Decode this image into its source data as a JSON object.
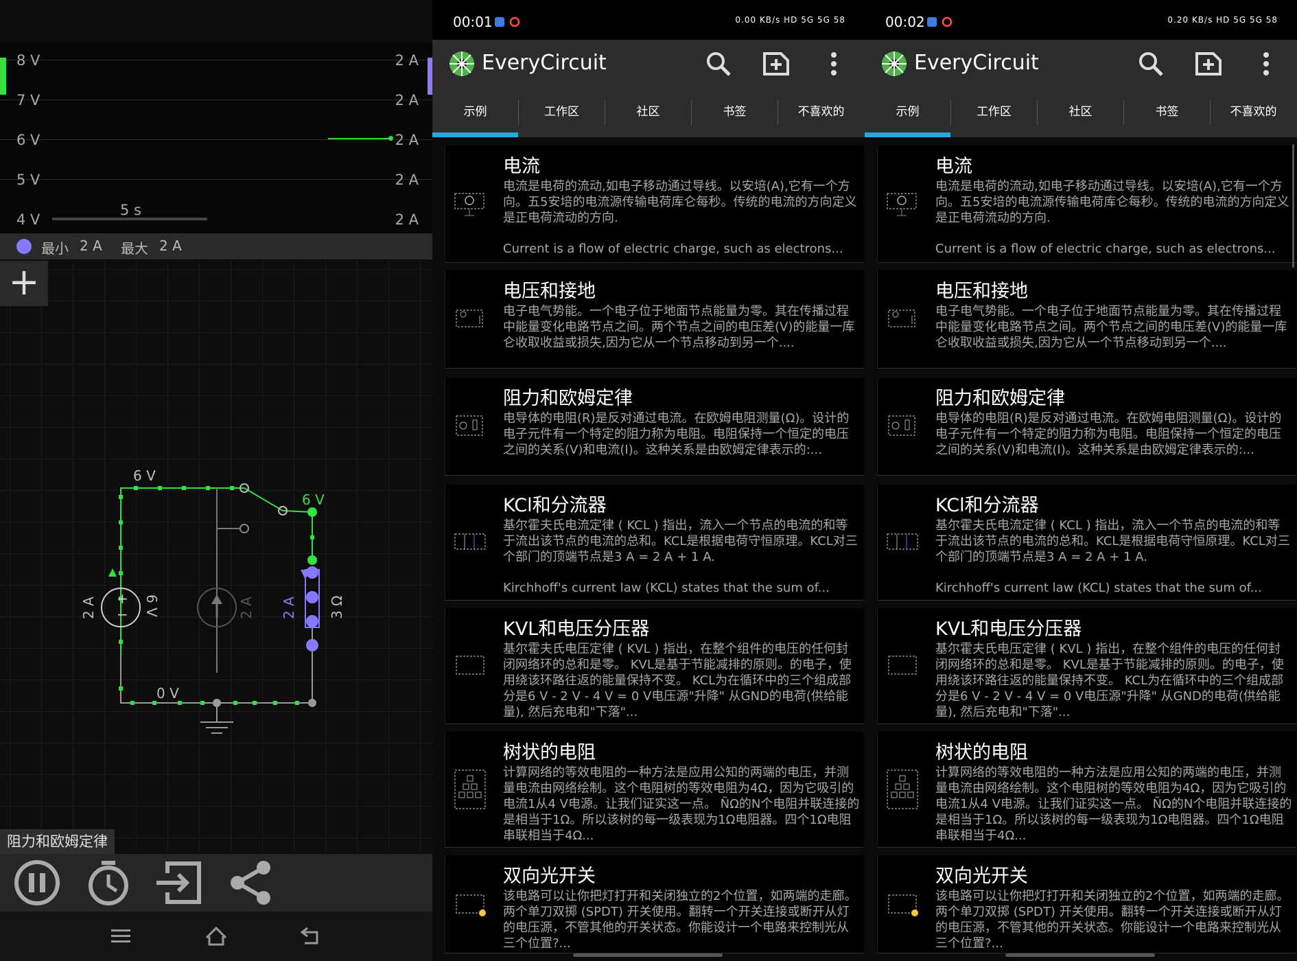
{
  "simulator": {
    "scope": {
      "rows": [
        {
          "left": "8 V",
          "right": "2 A"
        },
        {
          "left": "7 V",
          "right": "2 A"
        },
        {
          "left": "6 V",
          "right": "2 A"
        },
        {
          "left": "5 V",
          "right": "2 A"
        },
        {
          "left": "4 V",
          "right": "2 A"
        }
      ],
      "time_label": "5 s",
      "green_trace_level_v": 6
    },
    "legend": {
      "min_label": "最小",
      "min_value": "2 A",
      "max_label": "最大",
      "max_value": "2 A"
    },
    "add_icon": "plus-icon",
    "circuit_labels": {
      "top_node": "6 V",
      "right_node": "6 V",
      "ground_node": "0 V",
      "source1_current": "2 A",
      "source1_voltage": "6 V",
      "source2_current": "2 A",
      "resistor_current": "2 A",
      "resistor_value": "3 Ω"
    },
    "circuit_title": "阻力和欧姆定律",
    "toolbar_icons": [
      "pause-icon",
      "clock-icon",
      "export-icon",
      "share-icon"
    ],
    "nav_icons": [
      "menu-icon",
      "home-icon",
      "back-icon"
    ],
    "colors": {
      "voltage_green": "#33e040",
      "current_purple": "#8579ff",
      "wire_gray": "#9a9a9a"
    }
  },
  "panels": [
    {
      "status_time": "00:01",
      "status_right": "0.00 KB/s  HD  5G  5G  58",
      "app_title": "EveryCircuit",
      "tabs": [
        "示例",
        "工作区",
        "社区",
        "书签",
        "不喜欢的"
      ],
      "active_tab": 0
    },
    {
      "status_time": "00:02",
      "status_right": "0.20 KB/s  HD  5G  5G  58",
      "app_title": "EveryCircuit",
      "tabs": [
        "示例",
        "工作区",
        "社区",
        "书签",
        "不喜欢的"
      ],
      "active_tab": 0
    }
  ],
  "cards": [
    {
      "title": "电流",
      "desc": "电流是电荷的流动,如电子移动通过导线。以安培(A),它有一个方向。五5安培的电流源传输电荷库仑每秒。传统的电流的方向定义是正电荷流动的方向.",
      "en": "Current is a flow of electric charge, such as electrons..."
    },
    {
      "title": "电压和接地",
      "desc": "电子电气势能。一个电子位于地面节点能量为零。其在传播过程中能量变化电路节点之间。两个节点之间的电压差(V)的能量一库仑收取收益或损失,因为它从一个节点移动到另一个....",
      "en": ""
    },
    {
      "title": "阻力和欧姆定律",
      "desc": "电导体的电阻(R)是反对通过电流。在欧姆电阻测量(Ω)。设计的电子元件有一个特定的阻力称为电阻。电阻保持一个恒定的电压之间的关系(V)和电流(I)。这种关系是由欧姆定律表示的:...",
      "en": ""
    },
    {
      "title": "KCl和分流器",
      "desc": "基尔霍夫氏电流定律 ( KCL ) 指出，流入一个节点的电流的和等于流出该节点的电流的总和。KCL是根据电荷守恒原理。KCL对三个部门的顶端节点是3 A = 2 A + 1 A.",
      "en": "Kirchhoff's current law (KCL) states that the sum of..."
    },
    {
      "title": "KVL和电压分压器",
      "desc": "基尔霍夫氏电压定律 ( KVL ) 指出，在整个组件的电压的任何封闭网络环的总和是零。 KVL是基于节能减排的原则。的电子，使用绕该环路往返的能量保持不变。 KCL为在循环中的三个组成部分是6 V - 2 V - 4 V = 0 V电压源\"升降\" 从GND的电荷(供给能量), 然后充电和\"下落\"...",
      "en": ""
    },
    {
      "title": "树状的电阻",
      "desc": "计算网络的等效电阻的一种方法是应用公知的两端的电压，并测量电流由网络绘制。这个电阻树的等效电阻为4Ω，因为它吸引的电流1从4 V电源。让我们证实这一点。 ÑΩ的N个电阻并联连接的是相当于1Ω。所以该树的每一级表现为1Ω电阻器。四个1Ω电阻串联相当于4Ω...",
      "en": ""
    },
    {
      "title": "双向光开关",
      "desc": "该电路可以让你把灯打开和关闭独立的2个位置，如两端的走廊。两个单刀双掷 (SPDT) 开关使用。翻转一个开关连接或断开从灯的电压源，不管其他的开关状态。你能设计一个电路来控制光从三个位置?...",
      "en": ""
    }
  ],
  "app_icons": [
    "search-icon",
    "add-circuit-icon",
    "more-vert-icon"
  ]
}
